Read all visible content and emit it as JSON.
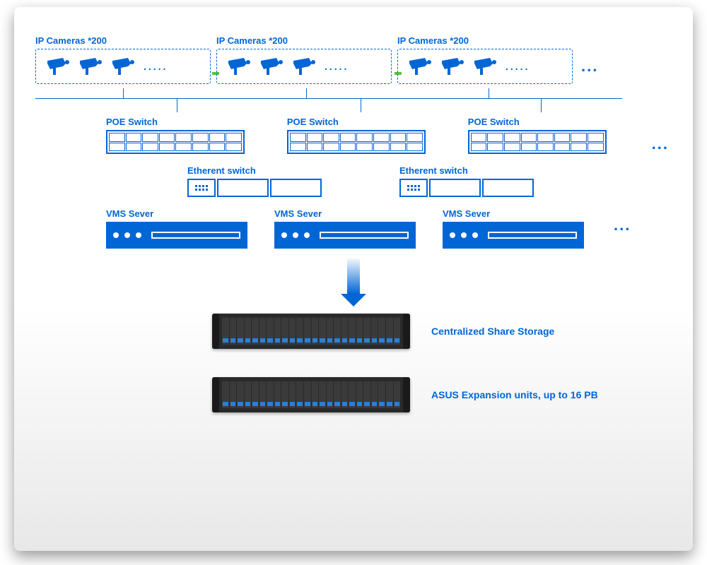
{
  "cameras": {
    "group_label": "IP Cameras *200",
    "ellipsis": "....."
  },
  "poe": {
    "label": "POE Switch"
  },
  "ethernet": {
    "label": "Etherent switch"
  },
  "vms": {
    "label": "VMS Sever"
  },
  "more": "...",
  "storage": {
    "shared_label": "Centralized Share Storage",
    "expansion_label": "ASUS Expansion units, up to 16 PB"
  }
}
